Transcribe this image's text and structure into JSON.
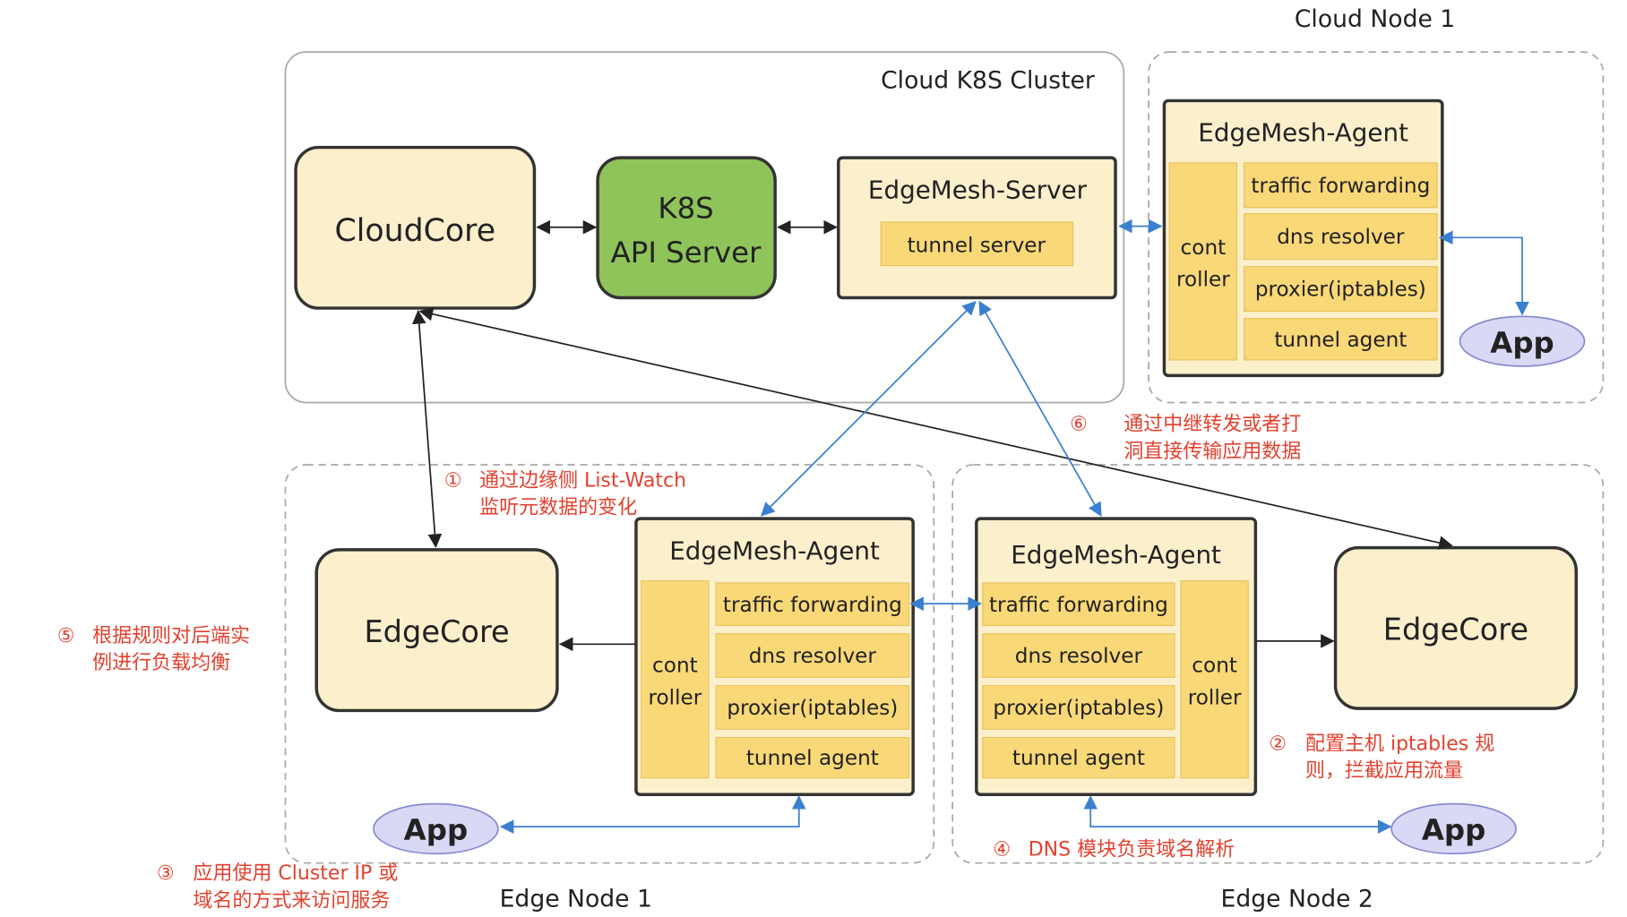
{
  "groups": {
    "cloud_cluster": "Cloud K8S Cluster",
    "cloud_node": "Cloud Node 1",
    "edge_node_1": "Edge Node  1",
    "edge_node_2": "Edge Node 2"
  },
  "components": {
    "cloudcore": "CloudCore",
    "k8s_line1": "K8S",
    "k8s_line2": "API Server",
    "server_title": "EdgeMesh-Server",
    "tunnel_server": "tunnel server",
    "edgecore_1": "EdgeCore",
    "edgecore_2": "EdgeCore",
    "app": "App"
  },
  "agent": {
    "title": "EdgeMesh-Agent",
    "controller_line1": "cont",
    "controller_line2": "roller",
    "modules": [
      "traffic forwarding",
      "dns resolver",
      "proxier(iptables)",
      "tunnel agent"
    ]
  },
  "annotations": {
    "a1": {
      "num": "①",
      "line1": "通过边缘侧 List-Watch",
      "line2": "监听元数据的变化"
    },
    "a2": {
      "num": "②",
      "line1": "配置主机 iptables 规",
      "line2": "则，拦截应用流量"
    },
    "a3": {
      "num": "③",
      "line1": "应用使用 Cluster IP 或",
      "line2": "域名的方式来访问服务"
    },
    "a4": {
      "num": "④",
      "line1": "DNS 模块负责域名解析"
    },
    "a5": {
      "num": "⑤",
      "line1": "根据规则对后端实",
      "line2": "例进行负载均衡"
    },
    "a6": {
      "num": "⑥",
      "line1": "通过中继转发或者打",
      "line2": "洞直接传输应用数据"
    }
  },
  "colors": {
    "box_fill": "#fcefcc",
    "module_fill": "#f9d878",
    "k8s_fill": "#8fc45a",
    "app_fill": "#d9d9f5",
    "annotation": "#e2412f",
    "data_link": "#3a7fd0"
  }
}
